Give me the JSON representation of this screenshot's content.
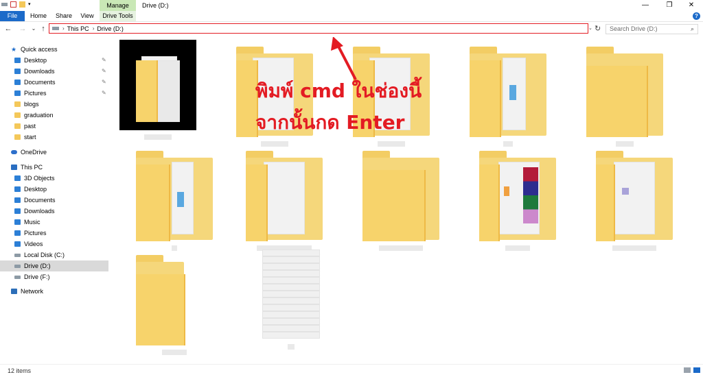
{
  "titlebar": {
    "manage_tab": "Manage",
    "window_title": "Drive (D:)",
    "minimize": "—",
    "maximize": "❐",
    "close": "✕"
  },
  "ribbon": {
    "tabs": [
      "File",
      "Home",
      "Share",
      "View",
      "Drive Tools"
    ],
    "help": "?"
  },
  "address": {
    "back": "←",
    "forward": "→",
    "recent": "⌄",
    "up": "↑",
    "segments": [
      "This PC",
      "Drive (D:)"
    ],
    "separator": "›",
    "dropdown": "⌄",
    "refresh": "↻",
    "search_placeholder": "Search Drive (D:)",
    "search_icon": "⌕"
  },
  "sidebar": {
    "items": [
      {
        "label": "Quick access",
        "icon": "star-icon",
        "indent": 0,
        "pinned": false
      },
      {
        "label": "Desktop",
        "icon": "desktop-icon",
        "indent": 1,
        "pinned": true
      },
      {
        "label": "Downloads",
        "icon": "downloads-icon",
        "indent": 1,
        "pinned": true
      },
      {
        "label": "Documents",
        "icon": "documents-icon",
        "indent": 1,
        "pinned": true
      },
      {
        "label": "Pictures",
        "icon": "pictures-icon",
        "indent": 1,
        "pinned": true
      },
      {
        "label": "blogs",
        "icon": "folder-icon",
        "indent": 1,
        "pinned": false
      },
      {
        "label": "graduation",
        "icon": "folder-icon",
        "indent": 1,
        "pinned": false
      },
      {
        "label": "past",
        "icon": "folder-icon",
        "indent": 1,
        "pinned": false
      },
      {
        "label": "start",
        "icon": "folder-icon",
        "indent": 1,
        "pinned": false
      },
      {
        "label": "OneDrive",
        "icon": "onedrive-icon",
        "indent": 0,
        "pinned": false
      },
      {
        "label": "This PC",
        "icon": "pc-icon",
        "indent": 0,
        "pinned": false
      },
      {
        "label": "3D Objects",
        "icon": "3d-objects-icon",
        "indent": 1,
        "pinned": false
      },
      {
        "label": "Desktop",
        "icon": "desktop-icon",
        "indent": 1,
        "pinned": false
      },
      {
        "label": "Documents",
        "icon": "documents-icon",
        "indent": 1,
        "pinned": false
      },
      {
        "label": "Downloads",
        "icon": "downloads-icon",
        "indent": 1,
        "pinned": false
      },
      {
        "label": "Music",
        "icon": "music-icon",
        "indent": 1,
        "pinned": false
      },
      {
        "label": "Pictures",
        "icon": "pictures-icon",
        "indent": 1,
        "pinned": false
      },
      {
        "label": "Videos",
        "icon": "videos-icon",
        "indent": 1,
        "pinned": false
      },
      {
        "label": "Local Disk (C:)",
        "icon": "disk-icon",
        "indent": 1,
        "pinned": false
      },
      {
        "label": "Drive (D:)",
        "icon": "disk-icon",
        "indent": 1,
        "pinned": false,
        "selected": true
      },
      {
        "label": "Drive (F:)",
        "icon": "disk-icon",
        "indent": 1,
        "pinned": false
      },
      {
        "label": "Network",
        "icon": "network-icon",
        "indent": 0,
        "pinned": false
      }
    ]
  },
  "annotation": {
    "line1": "พิมพ์ cmd ในช่องนี้",
    "line2": "จากนั้นกด Enter",
    "color": "#e31b23"
  },
  "status": {
    "item_count": "12 items"
  },
  "colors": {
    "accent": "#1b6ac9",
    "folder": "#f5d77b",
    "highlight": "#e31b23"
  }
}
